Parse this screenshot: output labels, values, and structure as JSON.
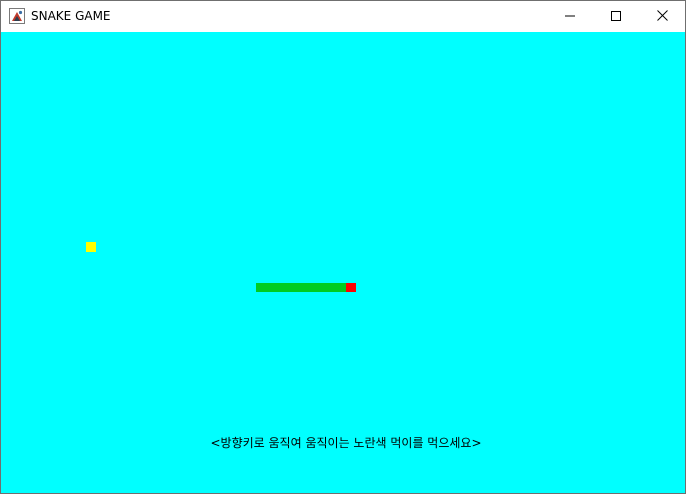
{
  "window": {
    "title": "SNAKE GAME",
    "icons": {
      "app": "java-app-icon",
      "minimize": "minimize-icon",
      "maximize": "maximize-icon",
      "close": "close-icon"
    }
  },
  "game": {
    "background_color": "#00ffff",
    "food_color": "#ffff00",
    "snake_body_color": "#00cc22",
    "snake_head_color": "#ff0000",
    "instruction": "<방향키로 움직여 움직이는 노란색 먹이를 먹으세요>"
  }
}
